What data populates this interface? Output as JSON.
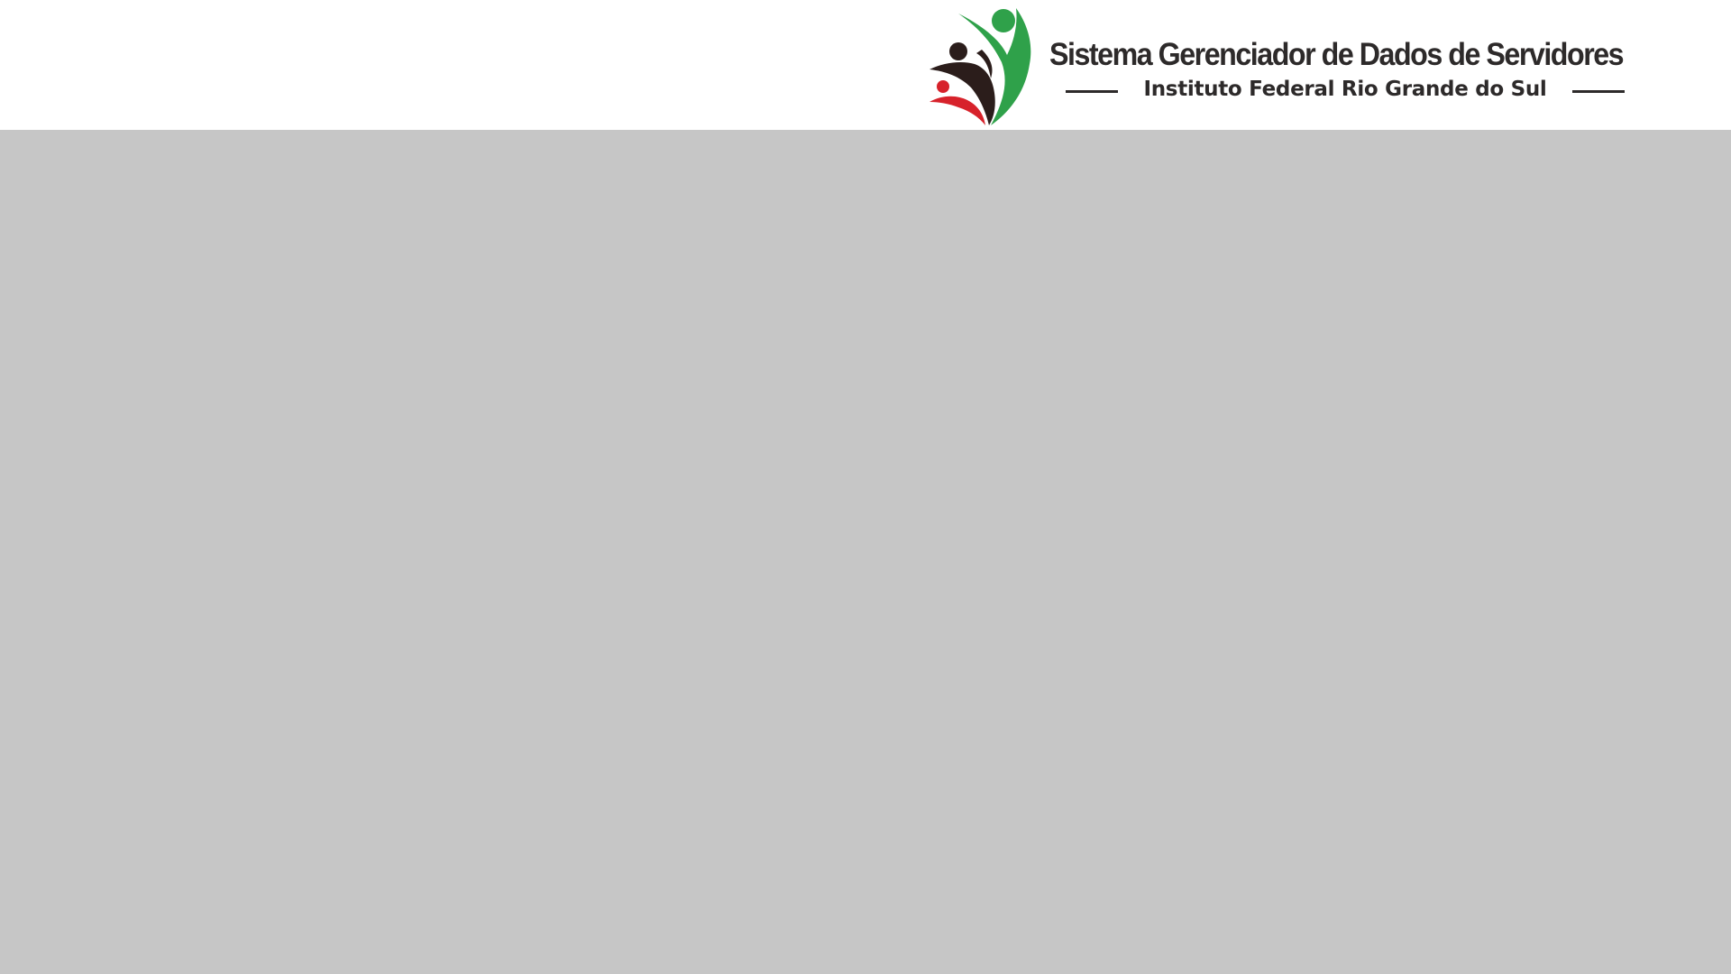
{
  "header": {
    "logo": {
      "icon": "people-celebration-logo-icon",
      "colors": {
        "green": "#2fa14a",
        "dark": "#2b1d1b",
        "red": "#d7222b"
      }
    },
    "system_title": "Sistema Gerenciador de Dados de Servidores",
    "institution_name": "Instituto Federal Rio Grande do Sul"
  },
  "colors": {
    "header_background": "#ffffff",
    "page_background": "#c6c6c6",
    "text": "#2d2a2a"
  }
}
